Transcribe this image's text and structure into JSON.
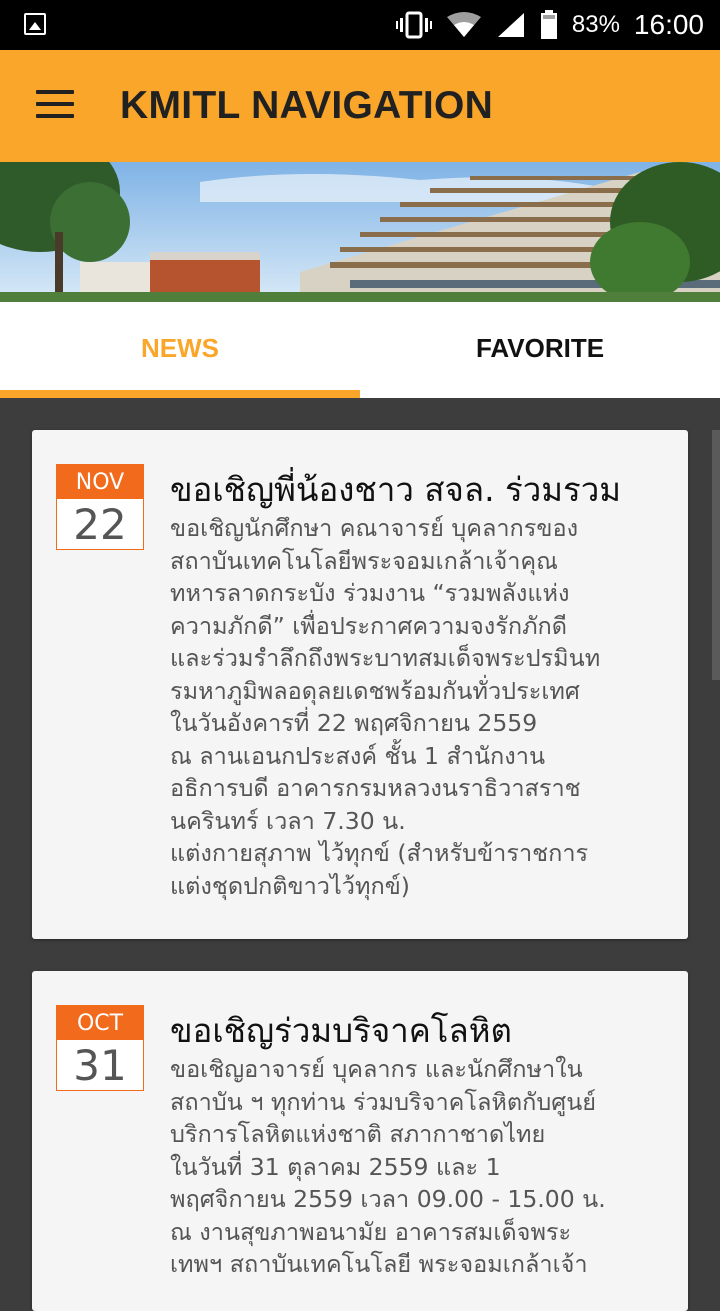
{
  "status_bar": {
    "battery_percent": "83%",
    "time": "16:00",
    "icons": [
      "image-icon",
      "vibrate-icon",
      "wifi-icon",
      "signal-icon",
      "battery-icon"
    ]
  },
  "app_bar": {
    "title": "KMITL NAVIGATION",
    "menu_icon": "hamburger-menu-icon",
    "color": "#f9a62b"
  },
  "tabs": [
    {
      "label": "NEWS",
      "selected": true
    },
    {
      "label": "FAVORITE",
      "selected": false
    }
  ],
  "news": [
    {
      "month": "NOV",
      "day": "22",
      "title": "ขอเชิญพี่น้องชาว สจล. ร่วมรวม",
      "body_lines": [
        "ขอเชิญนักศึกษา คณาจารย์ บุคลากรของ",
        "สถาบันเทคโนโลยีพระจอมเกล้าเจ้าคุณ",
        "ทหารลาดกระบัง ร่วมงาน “รวมพลังแห่ง",
        "ความภักดี” เพื่อประกาศความจงรักภักดี",
        "และร่วมรำลึกถึงพระบาทสมเด็จพระปรมินท",
        "รมหาภูมิพลอดุลยเดชพร้อมกันทั่วประเทศ",
        "ในวันอังคารที่ 22 พฤศจิกายน 2559",
        "ณ ลานเอนกประสงค์ ชั้น 1 สำนักงาน",
        "อธิการบดี อาคารกรมหลวงนราธิวาสราช",
        "นครินทร์ เวลา 7.30 น.",
        "แต่งกายสุภาพ ไว้ทุกข์ (สำหรับข้าราชการ",
        "แต่งชุดปกติขาวไว้ทุกข์)"
      ]
    },
    {
      "month": "OCT",
      "day": "31",
      "title": "ขอเชิญร่วมบริจาคโลหิต",
      "body_lines": [
        "ขอเชิญอาจารย์ บุคลากร และนักศึกษาใน",
        "สถาบัน ฯ ทุกท่าน ร่วมบริจาคโลหิตกับศูนย์",
        "บริการโลหิตแห่งชาติ สภากาชาดไทย",
        "ในวันที่ 31 ตุลาคม 2559 และ 1",
        "พฤศจิกายน 2559 เวลา 09.00 - 15.00 น.",
        "ณ งานสุขภาพอนามัย อาคารสมเด็จพระ",
        "เทพฯ สถาบันเทคโนโลยี พระจอมเกล้าเจ้า"
      ]
    }
  ],
  "colors": {
    "accent": "#f9a62b",
    "date_badge": "#f26a1b",
    "background": "#3d3d3d",
    "card": "#f5f5f5"
  }
}
